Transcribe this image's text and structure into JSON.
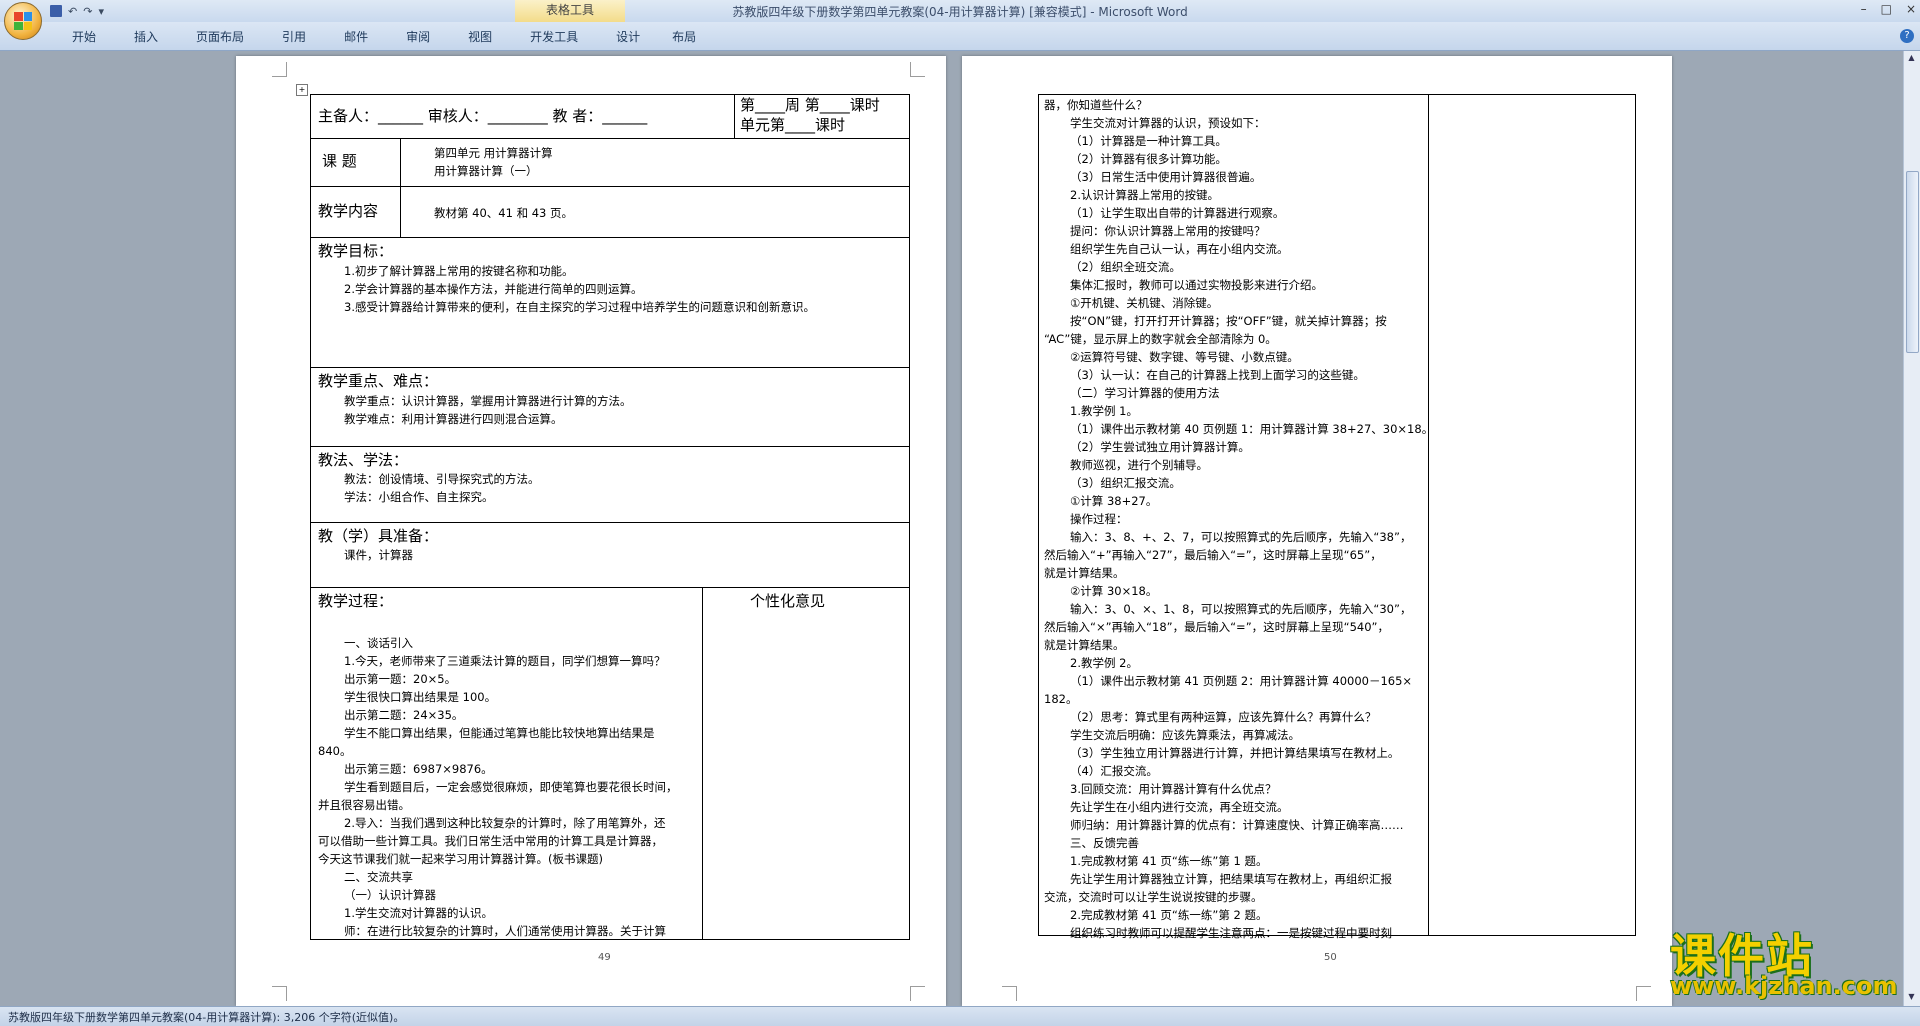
{
  "window": {
    "title": "苏教版四年级下册数学第四单元教案(04-用计算器计算) [兼容模式] - Microsoft Word",
    "contextual_tab_group": "表格工具",
    "controls": [
      "–",
      "□",
      "×"
    ]
  },
  "ribbon": {
    "tabs": [
      "开始",
      "插入",
      "页面布局",
      "引用",
      "邮件",
      "审阅",
      "视图",
      "开发工具"
    ],
    "context_tabs": [
      "设计",
      "布局"
    ]
  },
  "page1": {
    "header_left": "主备人：______  审核人：________  教    者：______",
    "header_right_1": "第____周 第____课时",
    "header_right_2": "单元第____课时",
    "lesson_label": "课      题",
    "lesson_line1": "第四单元 用计算器计算",
    "lesson_line2": "用计算器计算（一）",
    "content_label": "教学内容",
    "content_text": "教材第 40、41 和 43 页。",
    "goals_label": "教学目标：",
    "goals": [
      "1.初步了解计算器上常用的按键名称和功能。",
      "2.学会计算器的基本操作方法，并能进行简单的四则运算。",
      "3.感受计算器给计算带来的便利，在自主探究的学习过程中培养学生的问题意识和创新意识。"
    ],
    "key_label": "教学重点、难点：",
    "keys": [
      "教学重点：认识计算器，掌握用计算器进行计算的方法。",
      "教学难点：利用计算器进行四则混合运算。"
    ],
    "method_label": "教法、学法：",
    "methods": [
      "教法：创设情境、引导探究式的方法。",
      "学法：小组合作、自主探究。"
    ],
    "prep_label": "教（学）具准备：",
    "prep_text": "课件，计算器",
    "process_label": "教学过程：",
    "personal_label": "个性化意见",
    "process_lines": [
      "一、谈话引入",
      "1.今天，老师带来了三道乘法计算的题目，同学们想算一算吗？",
      "出示第一题：20×5。",
      "学生很快口算出结果是 100。",
      "出示第二题：24×35。",
      "学生不能口算出结果，但能通过笔算也能比较快地算出结果是",
      "840。",
      "出示第三题：6987×9876。",
      "学生看到题目后，一定会感觉很麻烦，即使笔算也要花很长时间，",
      "并且很容易出错。",
      "2.导入：当我们遇到这种比较复杂的计算时，除了用笔算外，还",
      "可以借助一些计算工具。我们日常生活中常用的计算工具是计算器，",
      "今天这节课我们就一起来学习用计算器计算。(板书课题)",
      "二、交流共享",
      "（一）认识计算器",
      "1.学生交流对计算器的认识。",
      "师：在进行比较复杂的计算时，人们通常使用计算器。关于计算"
    ],
    "page_number": "49"
  },
  "page2": {
    "lines": [
      "器，你知道些什么？",
      "学生交流对计算器的认识，预设如下：",
      "（1）计算器是一种计算工具。",
      "（2）计算器有很多计算功能。",
      "（3）日常生活中使用计算器很普遍。",
      "2.认识计算器上常用的按键。",
      "（1）让学生取出自带的计算器进行观察。",
      "提问：你认识计算器上常用的按键吗？",
      "组织学生先自己认一认，再在小组内交流。",
      "（2）组织全班交流。",
      "集体汇报时，教师可以通过实物投影来进行介绍。",
      "①开机键、关机键、消除键。",
      "按“ON”键，打开打开计算器；按“OFF”键，就关掉计算器；按",
      "“AC”键，显示屏上的数字就会全部清除为 0。",
      "②运算符号键、数字键、等号键、小数点键。",
      "（3）认一认：在自己的计算器上找到上面学习的这些键。",
      "（二）学习计算器的使用方法",
      "1.教学例 1。",
      "（1）课件出示教材第 40 页例题 1：用计算器计算 38+27、30×18。",
      "（2）学生尝试独立用计算器计算。",
      "教师巡视，进行个别辅导。",
      "（3）组织汇报交流。",
      "①计算 38+27。",
      "操作过程：",
      "输入：3、8、+、2、7，可以按照算式的先后顺序，先输入“38”，",
      "然后输入“+”再输入“27”，最后输入“=”，这时屏幕上呈现“65”，",
      "就是计算结果。",
      "②计算 30×18。",
      "输入：3、0、×、1、8，可以按照算式的先后顺序，先输入“30”，",
      "然后输入“×”再输入“18”，最后输入“=”，这时屏幕上呈现“540”，",
      "就是计算结果。",
      "2.教学例 2。",
      "（1）课件出示教材第 41 页例题 2：用计算器计算 40000－165×",
      "182。",
      "（2）思考：算式里有两种运算，应该先算什么？再算什么？",
      "学生交流后明确：应该先算乘法，再算减法。",
      "（3）学生独立用计算器进行计算，并把计算结果填写在教材上。",
      "（4）汇报交流。",
      "3.回顾交流：用计算器计算有什么优点？",
      "先让学生在小组内进行交流，再全班交流。",
      "师归纳：用计算器计算的优点有：计算速度快、计算正确率高……",
      "三、反馈完善",
      "1.完成教材第 41 页“练一练”第 1 题。",
      "先让学生用计算器独立计算，把结果填写在教材上，再组织汇报",
      "交流，交流时可以让学生说说按键的步骤。",
      "2.完成教材第 41 页“练一练”第 2 题。",
      "组织练习时教师可以提醒学生注意两点：一是按键过程中要时刻"
    ],
    "page_number": "50"
  },
  "status": {
    "text": "苏教版四年级下册数学第四单元教案(04-用计算器计算): 3,206 个字符(近似值)。"
  },
  "watermark": {
    "line1": "课件站",
    "line2": "www.kjzhan.com"
  }
}
